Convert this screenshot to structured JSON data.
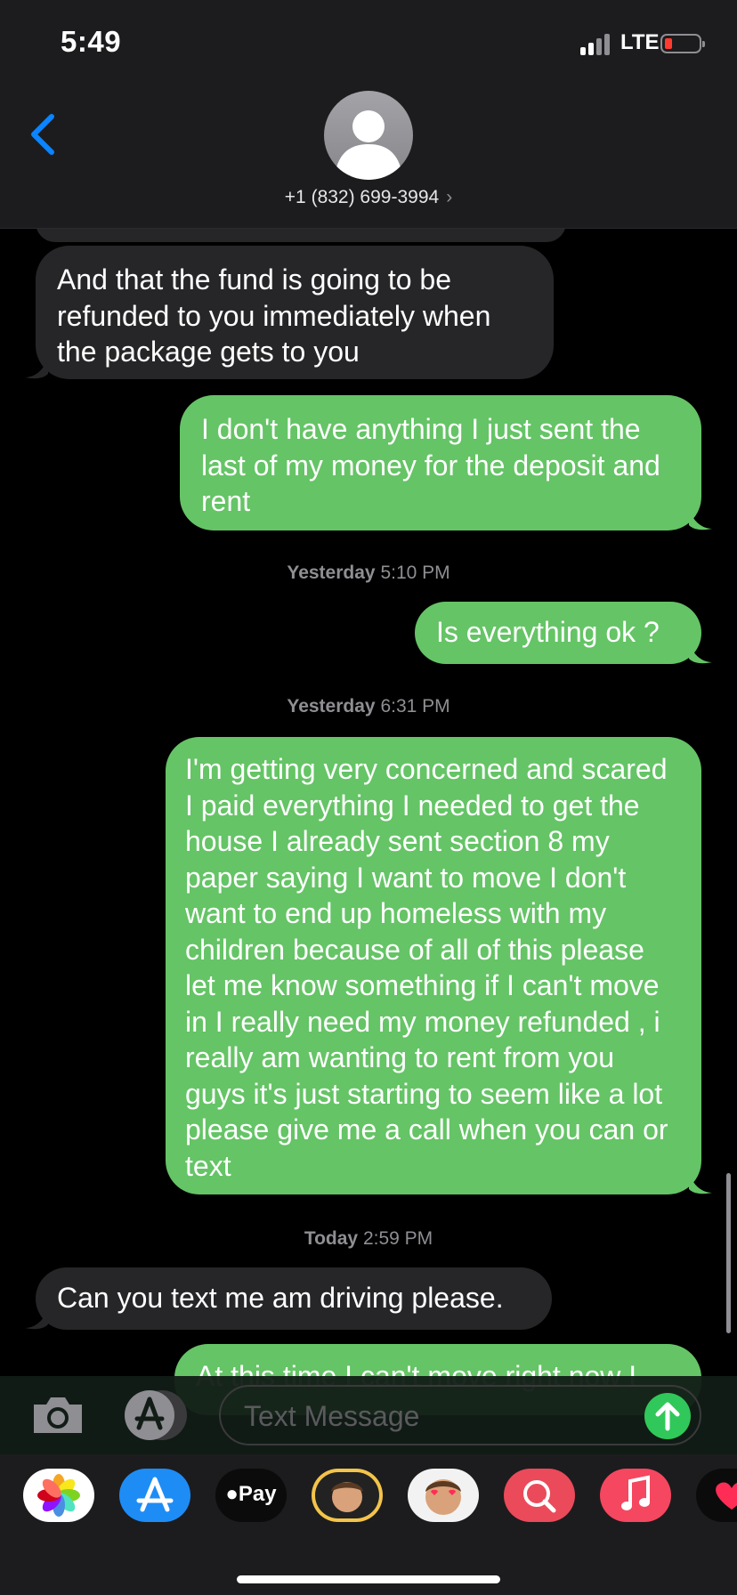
{
  "status_bar": {
    "time": "5:49",
    "network": "LTE",
    "battery_color": "#ff3b30"
  },
  "header": {
    "contact": "+1 (832) 699-3994",
    "chevron": "›",
    "back_icon": "chevron-left-icon",
    "avatar_icon": "person-icon"
  },
  "messages": [
    {
      "direction": "incoming",
      "text": "And that the fund is going to be refunded to you immediately when the package gets to you"
    },
    {
      "direction": "outgoing",
      "text": "I don't have anything I just sent the last of my money for the deposit and rent"
    },
    {
      "timestamp_day": "Yesterday",
      "timestamp_time": "5:10 PM"
    },
    {
      "direction": "outgoing",
      "text": "Is everything ok ?"
    },
    {
      "timestamp_day": "Yesterday",
      "timestamp_time": "6:31 PM"
    },
    {
      "direction": "outgoing",
      "text": "I'm getting very concerned and scared I paid everything I needed to get the house I already sent section 8 my paper saying I want to move I don't want to end up homeless with my children because of all of this please let me know something if I can't move in I really need my money refunded , i really am wanting to rent from you guys it's just starting to seem like a lot please give me a call when you can or text"
    },
    {
      "timestamp_day": "Today",
      "timestamp_time": "2:59 PM"
    },
    {
      "direction": "incoming",
      "text": "Can you text me am driving please."
    },
    {
      "direction": "outgoing",
      "text": "At this time I can't move right now I"
    }
  ],
  "input": {
    "placeholder": "Text Message",
    "camera_icon": "camera-icon",
    "apps_icon": "app-store-icon",
    "send_icon": "send-arrow-icon"
  },
  "app_drawer": {
    "items": [
      {
        "name": "Photos",
        "icon": "photos-icon"
      },
      {
        "name": "App Store",
        "icon": "app-store-icon"
      },
      {
        "name": "Apple Pay",
        "label": "Pay",
        "icon": "apple-pay-icon"
      },
      {
        "name": "Memoji",
        "icon": "memoji-icon"
      },
      {
        "name": "Memoji Stickers",
        "icon": "memoji-stickers-icon"
      },
      {
        "name": "Search Images",
        "icon": "image-search-icon"
      },
      {
        "name": "Music",
        "icon": "music-icon"
      },
      {
        "name": "Digital Touch",
        "icon": "digital-touch-icon"
      }
    ]
  },
  "colors": {
    "incoming_bubble": "#262628",
    "outgoing_bubble": "#65c466",
    "accent": "#0a84ff"
  }
}
